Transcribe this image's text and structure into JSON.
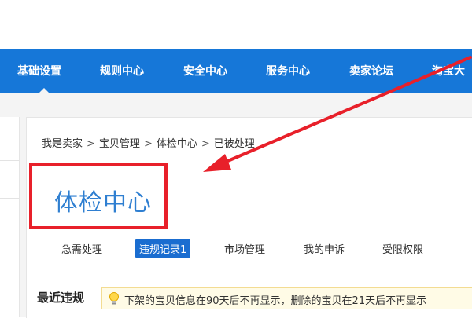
{
  "nav": {
    "items": [
      {
        "label": "基础设置"
      },
      {
        "label": "规则中心"
      },
      {
        "label": "安全中心"
      },
      {
        "label": "服务中心"
      },
      {
        "label": "卖家论坛"
      },
      {
        "label": "淘宝大"
      }
    ],
    "active_index": 0
  },
  "breadcrumb": [
    "我是卖家",
    "宝贝管理",
    "体检中心",
    "已被处理"
  ],
  "breadcrumb_separator": ">",
  "page_title": "体检中心",
  "tabs": [
    {
      "label": "急需处理"
    },
    {
      "label": "违规记录1"
    },
    {
      "label": "市场管理"
    },
    {
      "label": "我的申诉"
    },
    {
      "label": "受限权限"
    }
  ],
  "active_tab": 1,
  "recent": {
    "title": "最近违规",
    "notice": "下架的宝贝信息在90天后不再显示，删除的宝贝在21天后不再显示"
  },
  "colors": {
    "nav_bg": "#1677d8",
    "title": "#2f7fd1",
    "highlight": "#e8202a",
    "active_tab": "#1a6dd0"
  }
}
